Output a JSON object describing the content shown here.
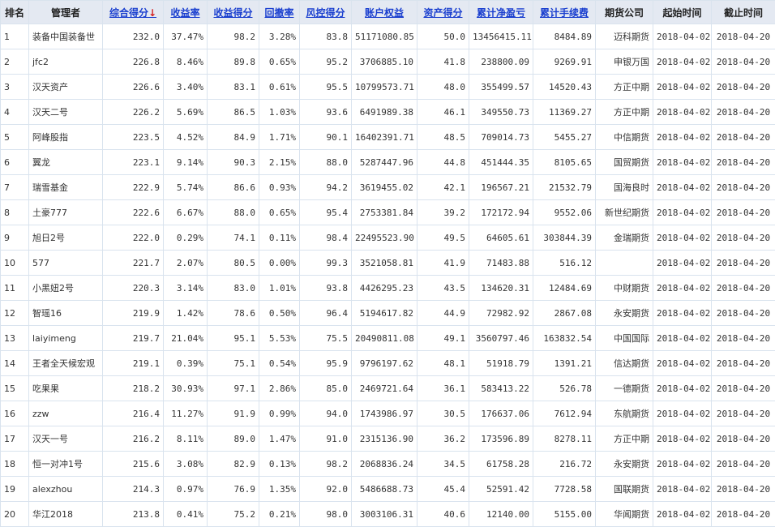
{
  "headers": {
    "rank": "排名",
    "manager": "管理者",
    "composite_score": "综合得分",
    "sort_arrow": "↓",
    "yield_rate": "收益率",
    "yield_score": "收益得分",
    "drawdown": "回撤率",
    "risk_score": "风控得分",
    "equity": "账户权益",
    "asset_score": "资产得分",
    "net_profit": "累计净盈亏",
    "fees": "累计手续费",
    "firm": "期货公司",
    "start": "起始时间",
    "end": "截止时间"
  },
  "colors": {
    "header_bg": "#e4e9f2",
    "link_blue": "#1a3fcf",
    "profit_red": "#d31f1f",
    "grid_line": "#d9e3ee"
  },
  "rows": [
    {
      "rank": "1",
      "manager": "装备中国装备世",
      "composite": "232.0",
      "yield_rate": "37.47%",
      "yield_score": "98.2",
      "drawdown": "3.28%",
      "risk": "83.8",
      "equity": "51171080.85",
      "asset": "50.0",
      "profit": "13456415.11",
      "fees": "8484.89",
      "firm": "迈科期货",
      "start": "2018-04-02",
      "end": "2018-04-20"
    },
    {
      "rank": "2",
      "manager": "jfc2",
      "composite": "226.8",
      "yield_rate": "8.46%",
      "yield_score": "89.8",
      "drawdown": "0.65%",
      "risk": "95.2",
      "equity": "3706885.10",
      "asset": "41.8",
      "profit": "238800.09",
      "fees": "9269.91",
      "firm": "申银万国",
      "start": "2018-04-02",
      "end": "2018-04-20"
    },
    {
      "rank": "3",
      "manager": "汉天资产",
      "composite": "226.6",
      "yield_rate": "3.40%",
      "yield_score": "83.1",
      "drawdown": "0.61%",
      "risk": "95.5",
      "equity": "10799573.71",
      "asset": "48.0",
      "profit": "355499.57",
      "fees": "14520.43",
      "firm": "方正中期",
      "start": "2018-04-02",
      "end": "2018-04-20"
    },
    {
      "rank": "4",
      "manager": "汉天二号",
      "composite": "226.2",
      "yield_rate": "5.69%",
      "yield_score": "86.5",
      "drawdown": "1.03%",
      "risk": "93.6",
      "equity": "6491989.38",
      "asset": "46.1",
      "profit": "349550.73",
      "fees": "11369.27",
      "firm": "方正中期",
      "start": "2018-04-02",
      "end": "2018-04-20"
    },
    {
      "rank": "5",
      "manager": "阿峰股指",
      "composite": "223.5",
      "yield_rate": "4.52%",
      "yield_score": "84.9",
      "drawdown": "1.71%",
      "risk": "90.1",
      "equity": "16402391.71",
      "asset": "48.5",
      "profit": "709014.73",
      "fees": "5455.27",
      "firm": "中信期货",
      "start": "2018-04-02",
      "end": "2018-04-20"
    },
    {
      "rank": "6",
      "manager": "翼龙",
      "composite": "223.1",
      "yield_rate": "9.14%",
      "yield_score": "90.3",
      "drawdown": "2.15%",
      "risk": "88.0",
      "equity": "5287447.96",
      "asset": "44.8",
      "profit": "451444.35",
      "fees": "8105.65",
      "firm": "国贸期货",
      "start": "2018-04-02",
      "end": "2018-04-20"
    },
    {
      "rank": "7",
      "manager": "瑞雪基金",
      "composite": "222.9",
      "yield_rate": "5.74%",
      "yield_score": "86.6",
      "drawdown": "0.93%",
      "risk": "94.2",
      "equity": "3619455.02",
      "asset": "42.1",
      "profit": "196567.21",
      "fees": "21532.79",
      "firm": "国海良时",
      "start": "2018-04-02",
      "end": "2018-04-20"
    },
    {
      "rank": "8",
      "manager": "土豪777",
      "composite": "222.6",
      "yield_rate": "6.67%",
      "yield_score": "88.0",
      "drawdown": "0.65%",
      "risk": "95.4",
      "equity": "2753381.84",
      "asset": "39.2",
      "profit": "172172.94",
      "fees": "9552.06",
      "firm": "新世纪期货",
      "start": "2018-04-02",
      "end": "2018-04-20"
    },
    {
      "rank": "9",
      "manager": "旭日2号",
      "composite": "222.0",
      "yield_rate": "0.29%",
      "yield_score": "74.1",
      "drawdown": "0.11%",
      "risk": "98.4",
      "equity": "22495523.90",
      "asset": "49.5",
      "profit": "64605.61",
      "fees": "303844.39",
      "firm": "金瑞期货",
      "start": "2018-04-02",
      "end": "2018-04-20"
    },
    {
      "rank": "10",
      "manager": "577",
      "composite": "221.7",
      "yield_rate": "2.07%",
      "yield_score": "80.5",
      "drawdown": "0.00%",
      "risk": "99.3",
      "equity": "3521058.81",
      "asset": "41.9",
      "profit": "71483.88",
      "fees": "516.12",
      "firm": "",
      "start": "2018-04-02",
      "end": "2018-04-20"
    },
    {
      "rank": "11",
      "manager": "小黑妞2号",
      "composite": "220.3",
      "yield_rate": "3.14%",
      "yield_score": "83.0",
      "drawdown": "1.01%",
      "risk": "93.8",
      "equity": "4426295.23",
      "asset": "43.5",
      "profit": "134620.31",
      "fees": "12484.69",
      "firm": "中财期货",
      "start": "2018-04-02",
      "end": "2018-04-20"
    },
    {
      "rank": "12",
      "manager": "智瑶16",
      "composite": "219.9",
      "yield_rate": "1.42%",
      "yield_score": "78.6",
      "drawdown": "0.50%",
      "risk": "96.4",
      "equity": "5194617.82",
      "asset": "44.9",
      "profit": "72982.92",
      "fees": "2867.08",
      "firm": "永安期货",
      "start": "2018-04-02",
      "end": "2018-04-20"
    },
    {
      "rank": "13",
      "manager": "laiyimeng",
      "composite": "219.7",
      "yield_rate": "21.04%",
      "yield_score": "95.1",
      "drawdown": "5.53%",
      "risk": "75.5",
      "equity": "20490811.08",
      "asset": "49.1",
      "profit": "3560797.46",
      "fees": "163832.54",
      "firm": "中国国际",
      "start": "2018-04-02",
      "end": "2018-04-20"
    },
    {
      "rank": "14",
      "manager": "王者全天候宏观",
      "composite": "219.1",
      "yield_rate": "0.39%",
      "yield_score": "75.1",
      "drawdown": "0.54%",
      "risk": "95.9",
      "equity": "9796197.62",
      "asset": "48.1",
      "profit": "51918.79",
      "fees": "1391.21",
      "firm": "信达期货",
      "start": "2018-04-02",
      "end": "2018-04-20"
    },
    {
      "rank": "15",
      "manager": "吃果果",
      "composite": "218.2",
      "yield_rate": "30.93%",
      "yield_score": "97.1",
      "drawdown": "2.86%",
      "risk": "85.0",
      "equity": "2469721.64",
      "asset": "36.1",
      "profit": "583413.22",
      "fees": "526.78",
      "firm": "一德期货",
      "start": "2018-04-02",
      "end": "2018-04-20"
    },
    {
      "rank": "16",
      "manager": "zzw",
      "composite": "216.4",
      "yield_rate": "11.27%",
      "yield_score": "91.9",
      "drawdown": "0.99%",
      "risk": "94.0",
      "equity": "1743986.97",
      "asset": "30.5",
      "profit": "176637.06",
      "fees": "7612.94",
      "firm": "东航期货",
      "start": "2018-04-02",
      "end": "2018-04-20"
    },
    {
      "rank": "17",
      "manager": "汉天一号",
      "composite": "216.2",
      "yield_rate": "8.11%",
      "yield_score": "89.0",
      "drawdown": "1.47%",
      "risk": "91.0",
      "equity": "2315136.90",
      "asset": "36.2",
      "profit": "173596.89",
      "fees": "8278.11",
      "firm": "方正中期",
      "start": "2018-04-02",
      "end": "2018-04-20"
    },
    {
      "rank": "18",
      "manager": "恒一对冲1号",
      "composite": "215.6",
      "yield_rate": "3.08%",
      "yield_score": "82.9",
      "drawdown": "0.13%",
      "risk": "98.2",
      "equity": "2068836.24",
      "asset": "34.5",
      "profit": "61758.28",
      "fees": "216.72",
      "firm": "永安期货",
      "start": "2018-04-02",
      "end": "2018-04-20"
    },
    {
      "rank": "19",
      "manager": "alexzhou",
      "composite": "214.3",
      "yield_rate": "0.97%",
      "yield_score": "76.9",
      "drawdown": "1.35%",
      "risk": "92.0",
      "equity": "5486688.73",
      "asset": "45.4",
      "profit": "52591.42",
      "fees": "7728.58",
      "firm": "国联期货",
      "start": "2018-04-02",
      "end": "2018-04-20"
    },
    {
      "rank": "20",
      "manager": "华江2018",
      "composite": "213.8",
      "yield_rate": "0.41%",
      "yield_score": "75.2",
      "drawdown": "0.21%",
      "risk": "98.0",
      "equity": "3003106.31",
      "asset": "40.6",
      "profit": "12140.00",
      "fees": "5155.00",
      "firm": "华闻期货",
      "start": "2018-04-02",
      "end": "2018-04-20"
    }
  ]
}
